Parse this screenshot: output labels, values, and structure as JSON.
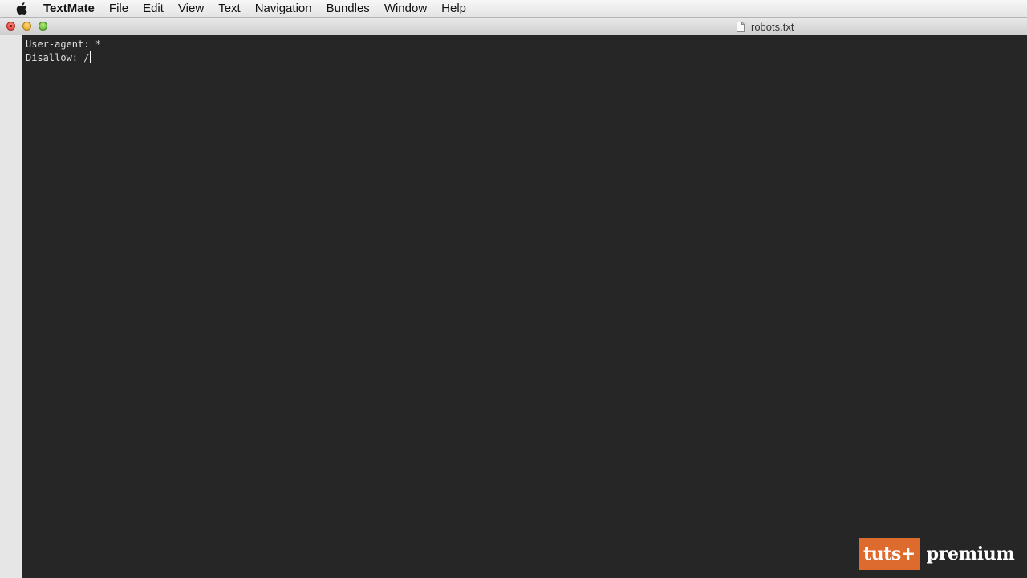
{
  "menubar": {
    "apple_icon": "apple-icon",
    "app_name": "TextMate",
    "items": [
      "File",
      "Edit",
      "View",
      "Text",
      "Navigation",
      "Bundles",
      "Window",
      "Help"
    ]
  },
  "window": {
    "title": "robots.txt",
    "title_icon": "document-icon",
    "buttons": {
      "close_color": "#d8322a",
      "minimize_color": "#e0a11d",
      "zoom_color": "#4fae2a"
    }
  },
  "editor": {
    "background": "#262626",
    "lines": [
      "User-agent: *",
      "Disallow: /"
    ]
  },
  "watermark": {
    "box_text": "tuts+",
    "text": "premium",
    "accent": "#de6b2e"
  }
}
